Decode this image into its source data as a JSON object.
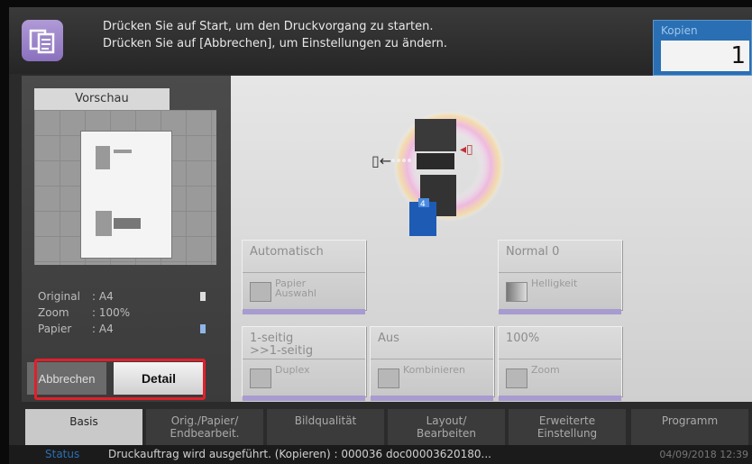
{
  "header": {
    "message_line1": "Drücken Sie auf Start, um den Druckvorgang zu starten.",
    "message_line2": "Drücken Sie auf [Abbrechen], um Einstellungen zu ändern.",
    "copies_label": "Kopien",
    "copies_value": "1"
  },
  "preview": {
    "tab_label": "Vorschau",
    "info": [
      {
        "key": "Original",
        "value": ": A4"
      },
      {
        "key": "Zoom",
        "value": ": 100%"
      },
      {
        "key": "Papier",
        "value": ": A4"
      }
    ],
    "cancel_label": "Abbrechen",
    "detail_label": "Detail"
  },
  "functions": {
    "paper": {
      "value": "Automatisch",
      "label_line1": "Papier",
      "label_line2": "Auswahl"
    },
    "density": {
      "value": "Normal 0",
      "label": "Helligkeit"
    },
    "duplex": {
      "value_line1": "1-seitig",
      "value_line2": ">>1-seitig",
      "label": "Duplex"
    },
    "combine": {
      "value": "Aus",
      "label": "Kombinieren"
    },
    "zoom": {
      "value": "100%",
      "label": "Zoom"
    }
  },
  "tabs": [
    {
      "line1": "Basis",
      "line2": ""
    },
    {
      "line1": "Orig./Papier/",
      "line2": "Endbearbeit."
    },
    {
      "line1": "Bildqualität",
      "line2": ""
    },
    {
      "line1": "Layout/",
      "line2": "Bearbeiten"
    },
    {
      "line1": "Erweiterte",
      "line2": "Einstellung"
    },
    {
      "line1": "Programm",
      "line2": ""
    }
  ],
  "status": {
    "label": "Status",
    "message": "Druckauftrag wird ausgeführt. (Kopieren) : 000036 doc00003620180...",
    "datetime": "04/09/2018  12:39"
  },
  "colors": {
    "accent_purple": "#8a70bd",
    "copies_blue": "#2a6fb3",
    "highlight_red": "#e0202a"
  }
}
